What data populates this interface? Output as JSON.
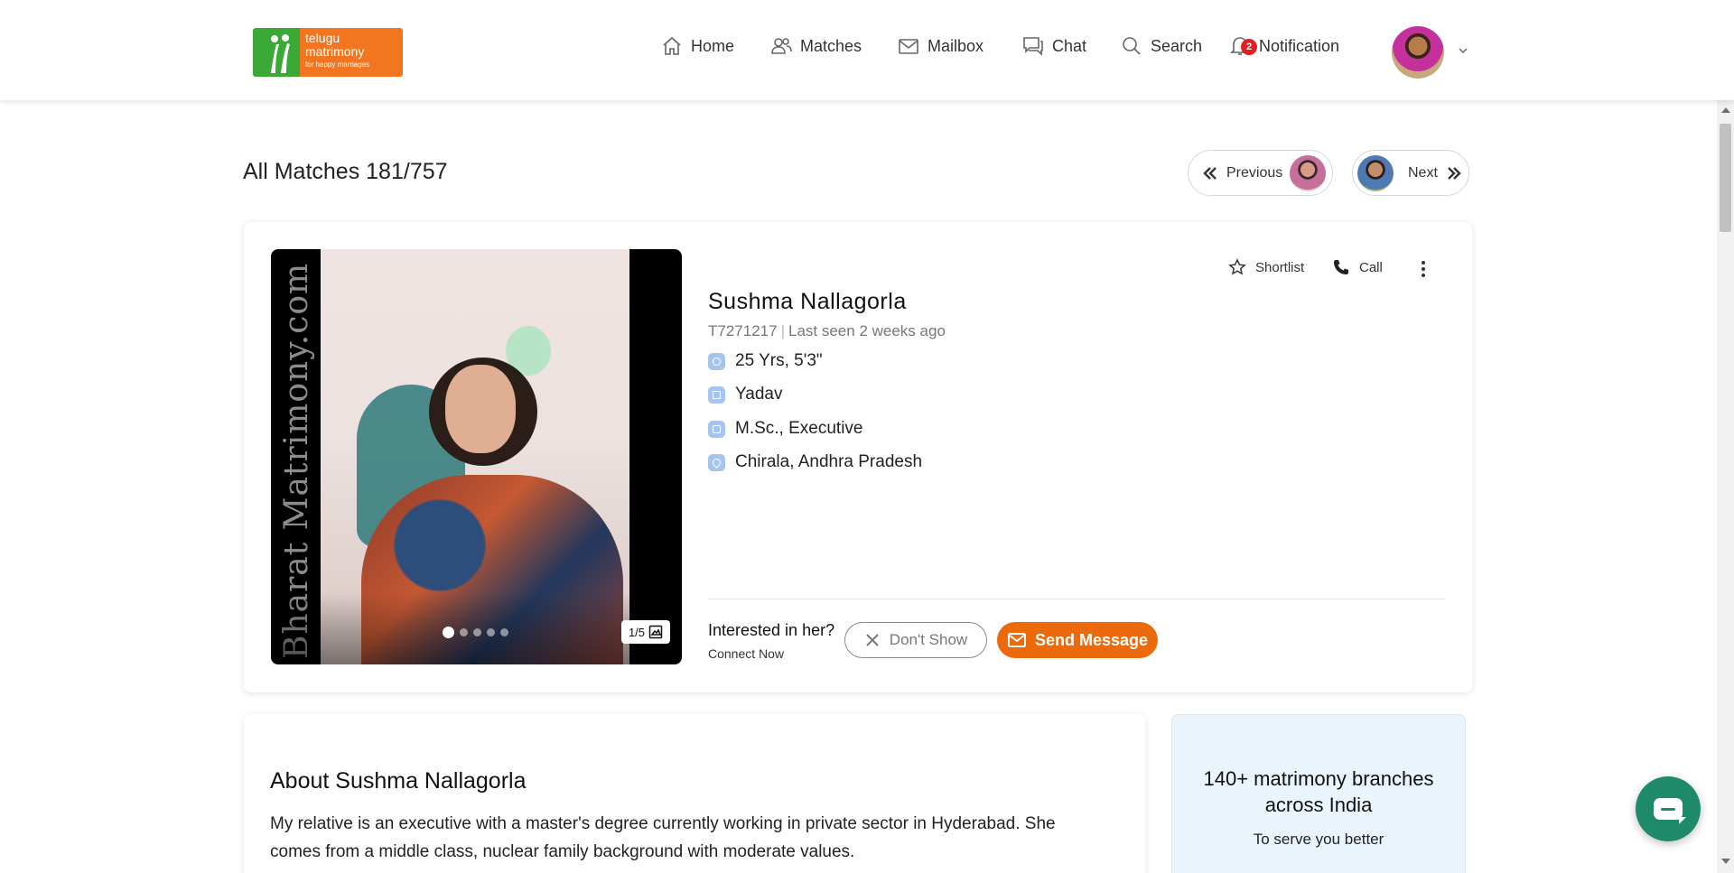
{
  "brand": {
    "line1": "telugu",
    "line2": "matrimony",
    "tagline": "for happy marriages",
    "colors": {
      "green": "#3aa935",
      "orange": "#f1761f"
    }
  },
  "nav": {
    "home": "Home",
    "matches": "Matches",
    "mailbox": "Mailbox",
    "chat": "Chat",
    "search": "Search",
    "notification": "Notification",
    "notification_count": "2"
  },
  "pager": {
    "title": "All Matches 181/757",
    "previous": "Previous",
    "next": "Next"
  },
  "profile": {
    "name": "Sushma Nallagorla",
    "id": "T7271217",
    "last_seen": "Last seen 2 weeks ago",
    "details": [
      {
        "icon": "age-height-icon",
        "text": "25 Yrs, 5'3\""
      },
      {
        "icon": "caste-icon",
        "text": "Yadav"
      },
      {
        "icon": "education-icon",
        "text": "M.Sc., Executive"
      },
      {
        "icon": "location-icon",
        "text": "Chirala, Andhra Pradesh"
      }
    ],
    "photo": {
      "watermark": "Bharat Matrimony.com",
      "counter": "1/5",
      "total_photos": 5,
      "active_index": 1
    },
    "actions": {
      "shortlist": "Shortlist",
      "call": "Call"
    },
    "interest": {
      "question": "Interested in her?",
      "sub": "Connect Now",
      "dont_show": "Don't Show",
      "send_message": "Send Message"
    },
    "accent_color": "#ea6a0c"
  },
  "about": {
    "title": "About Sushma Nallagorla",
    "text": "My relative is an executive with a master's degree currently working in private sector in Hyderabad. She comes from a middle class, nuclear family background with moderate values."
  },
  "branches": {
    "title": "140+ matrimony branches across India",
    "subtitle": "To serve you better"
  }
}
